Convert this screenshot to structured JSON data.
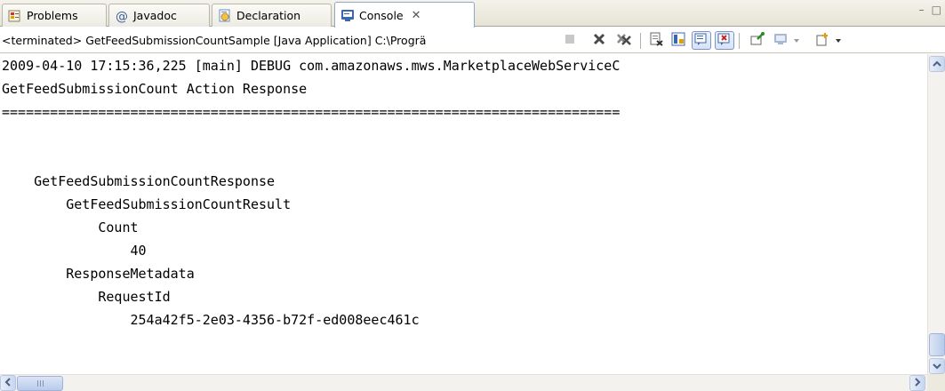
{
  "tabs": [
    {
      "label": "Problems",
      "icon": "problems-icon",
      "active": false
    },
    {
      "label": "Javadoc",
      "icon": "at-sign-icon",
      "active": false
    },
    {
      "label": "Declaration",
      "icon": "declaration-icon",
      "active": false
    },
    {
      "label": "Console",
      "icon": "console-icon",
      "active": true,
      "close": "✕"
    }
  ],
  "view_controls": {
    "minimize": "–",
    "maximize": "□"
  },
  "toolbar": {
    "status": "<terminated> GetFeedSubmissionCountSample [Java Application] C:\\Progrä",
    "buttons": [
      "terminate-icon",
      "remove-launch-icon",
      "remove-all-terminated-icon",
      "clear-console-icon",
      "scroll-lock-icon",
      "show-stdout-icon",
      "show-stderr-icon",
      "pin-console-icon",
      "display-console-icon",
      "open-console-icon"
    ]
  },
  "console": {
    "lines": [
      "2009-04-10 17:15:36,225 [main] DEBUG com.amazonaws.mws.MarketplaceWebServiceC",
      "GetFeedSubmissionCount Action Response",
      "=============================================================================",
      "",
      "",
      "    GetFeedSubmissionCountResponse",
      "        GetFeedSubmissionCountResult",
      "            Count",
      "                40",
      "        ResponseMetadata",
      "            RequestId",
      "                254a42f5-2e03-4356-b72f-ed008eec461c"
    ]
  },
  "colors": {
    "accent": "#3c67b0",
    "tabbar": "#ece9d8",
    "scroll": "#c7d6ef"
  }
}
